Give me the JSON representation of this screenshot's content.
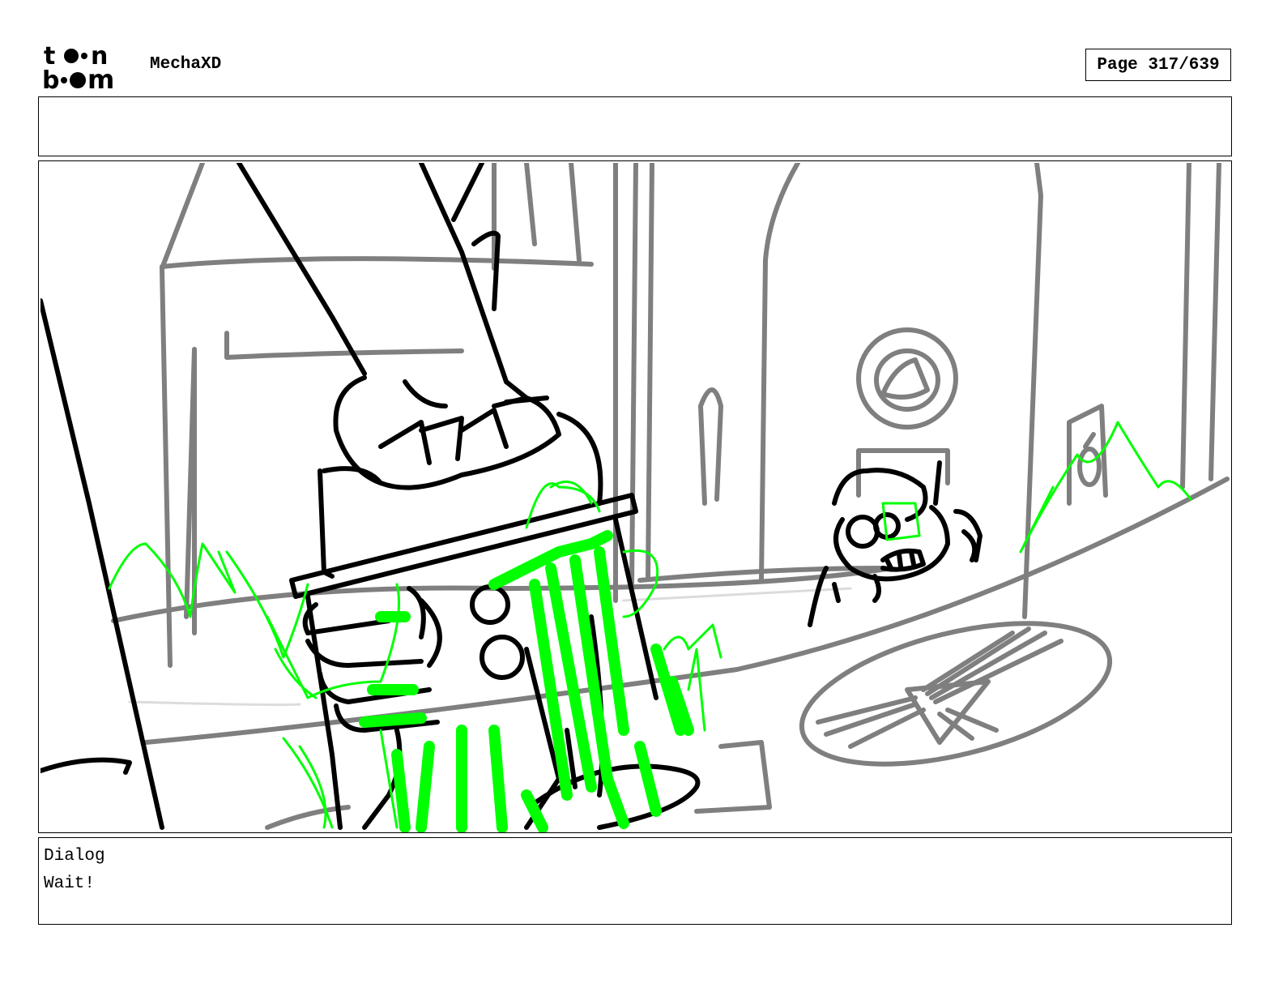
{
  "header": {
    "logo_text": [
      "t",
      "n",
      "b",
      "m"
    ],
    "project_name": "MechaXD",
    "page_label": "Page 317/639"
  },
  "notes": {
    "text": ""
  },
  "dialog": {
    "label": "Dialog",
    "text": "Wait!"
  },
  "colors": {
    "ink": "#000000",
    "sketch_gray": "#7f7f7f",
    "highlight_green": "#00ff00"
  }
}
